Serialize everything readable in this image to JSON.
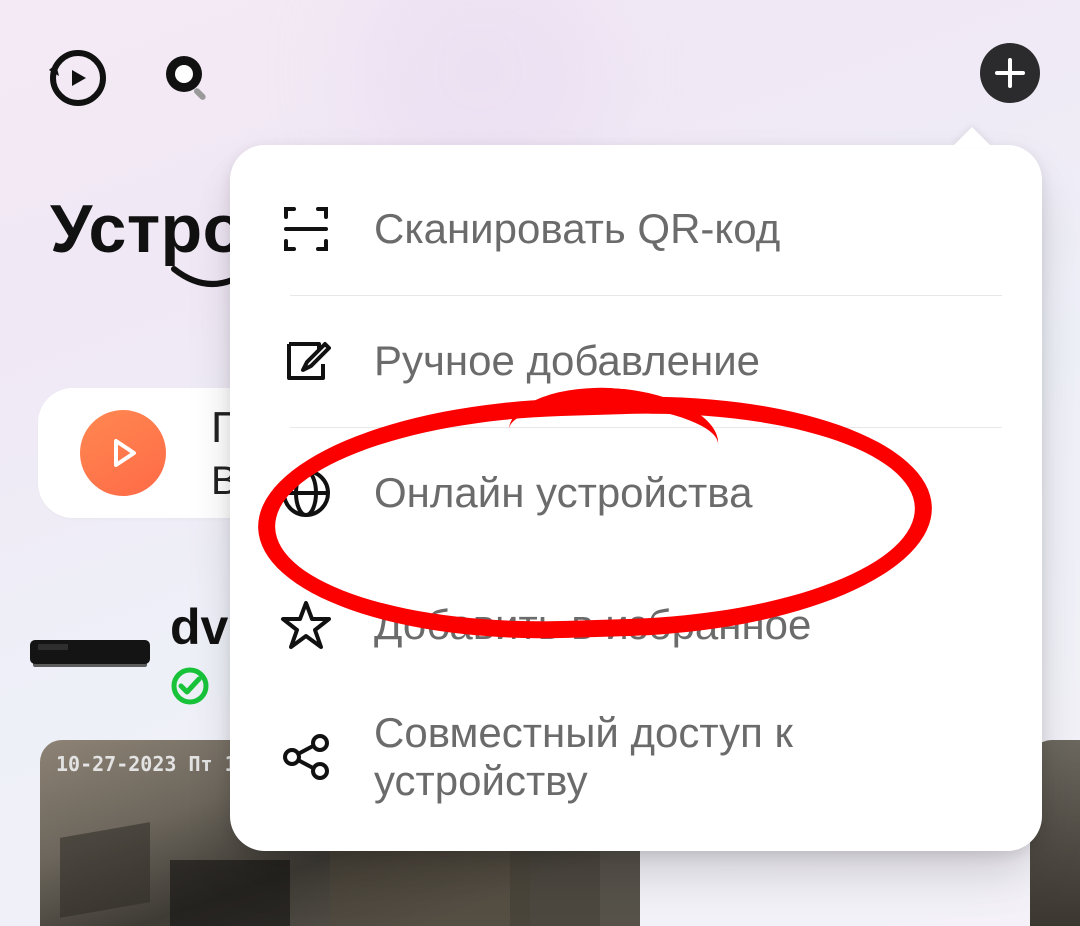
{
  "header": {
    "title": "Устройства"
  },
  "recent": {
    "line1": "П",
    "line2": "В"
  },
  "device": {
    "name": "dvr"
  },
  "camera": {
    "timestamp": "10-27-2023 Пт 1"
  },
  "add_menu": {
    "scan_qr": "Сканировать QR-код",
    "manual": "Ручное добавление",
    "online": "Онлайн устройства",
    "favorite": "Добавить в избранное",
    "share": "Совместный доступ к устройству"
  }
}
